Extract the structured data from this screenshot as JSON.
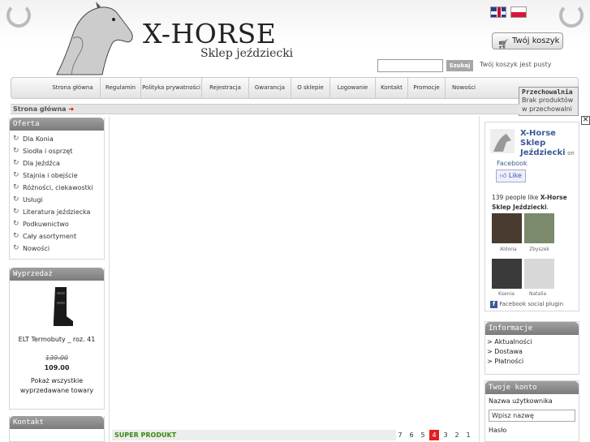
{
  "header": {
    "brand": "X-HORSE",
    "tagline": "Sklep jeździecki",
    "cart_button": "Twój koszyk",
    "search_button": "Szukaj",
    "cart_status": "Twój koszyk jest pusty"
  },
  "nav": {
    "items": [
      "Strona główna",
      "Regulamin",
      "Polityka prywatności",
      "Rejestracja",
      "Gwarancja",
      "O sklepie",
      "Logowanie",
      "Kontakt",
      "Promocje",
      "Nowości"
    ]
  },
  "storage": {
    "title": "Przechowalnia",
    "text": "Brak produktów w przechowalni"
  },
  "breadcrumb": {
    "current": "Strona główna"
  },
  "offer": {
    "title": "Oferta",
    "items": [
      "Dla Konia",
      "Siodła i osprzęt",
      "Dla Jeźdźca",
      "Stajnia i obejście",
      "Różności, ciekawostki",
      "Usługi",
      "Literatura jeździecka",
      "Podkuwnictwo",
      "Cały asortyment",
      "Nowości"
    ]
  },
  "sale": {
    "title": "Wyprzedaż",
    "product_name": "ELT Termobuty _ roz. 41",
    "old_price": "139.00",
    "new_price": "109.00",
    "show_all": "Pokaż wszystkie wyprzedawane towary"
  },
  "contact": {
    "title": "Kontakt"
  },
  "main": {
    "super_product": "SUPER PRODUKT",
    "pages": [
      "7",
      "6",
      "5",
      "4",
      "3",
      "2",
      "1"
    ],
    "active_page": "4"
  },
  "facebook": {
    "page_name": "X-Horse Sklep Jeździecki",
    "on": "on",
    "platform": "Facebook",
    "like": "Like",
    "likes_prefix": "139 people like",
    "likes_page": "X-Horse Sklep Jeździecki",
    "fans": [
      "Aldona",
      "Zbyszek",
      "Kseniа",
      "Natalia"
    ],
    "plugin": "Facebook social plugin"
  },
  "info": {
    "title": "Informacje",
    "items": [
      "Aktualności",
      "Dostawa",
      "Płatności"
    ]
  },
  "account": {
    "title": "Twoje konto",
    "username_label": "Nazwa użytkownika",
    "username_placeholder": "Wpisz nazwę",
    "password_label": "Hasło"
  },
  "colors": {
    "nav_bg": "#e3e3e3",
    "box_head": "#8a8a8a",
    "active_page": "#e41e1e",
    "super_product": "#3a8a10",
    "facebook_blue": "#3b5998"
  }
}
